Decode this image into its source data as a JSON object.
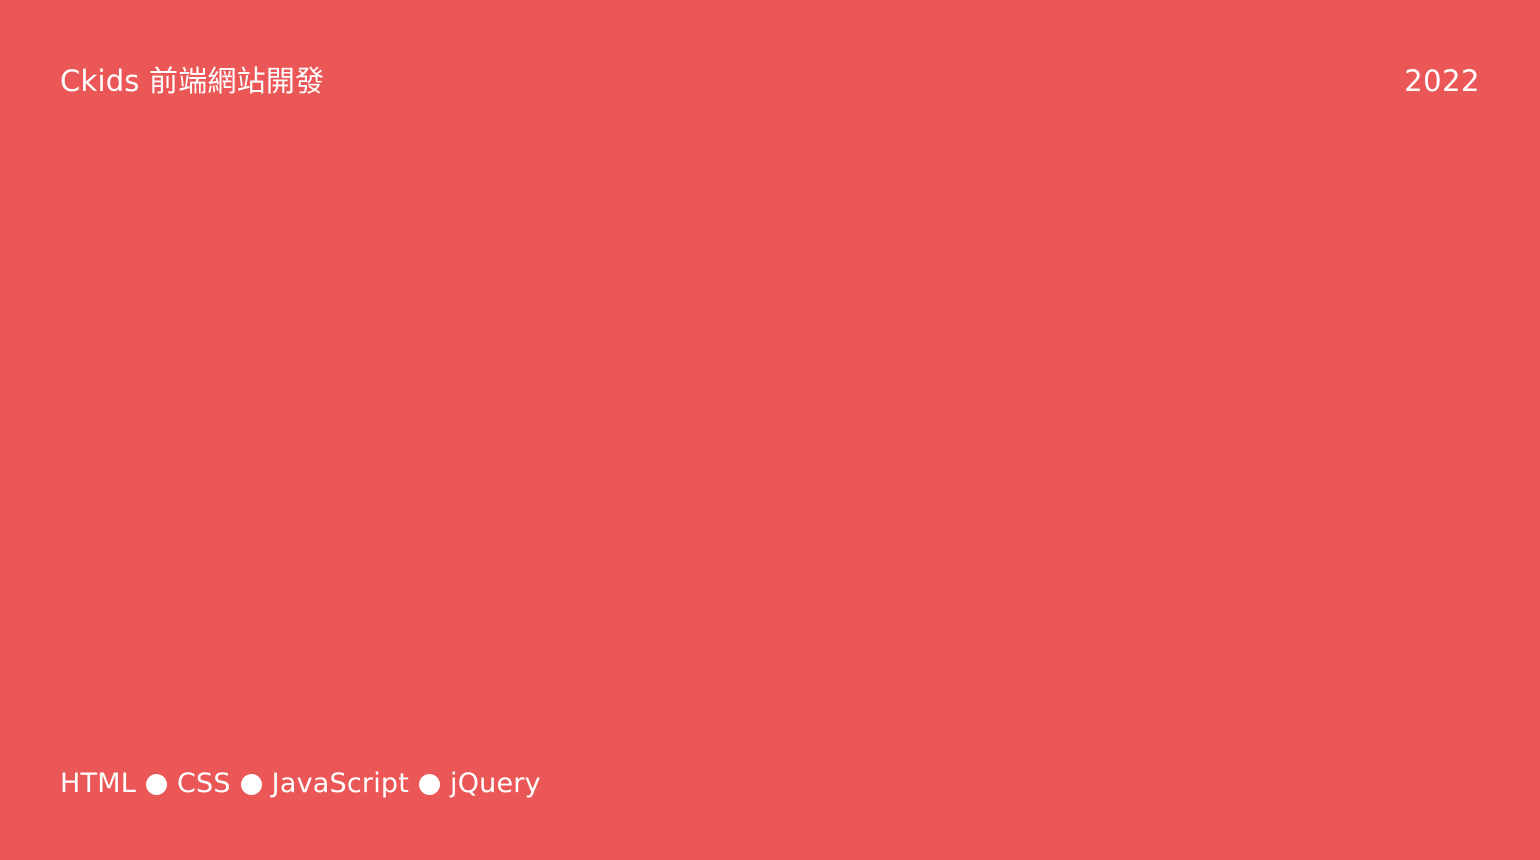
{
  "header": {
    "title": "Ckids 前端網站開發",
    "year": "2022"
  },
  "footer": {
    "tech_stack": [
      "HTML",
      "CSS",
      "JavaScript",
      "jQuery"
    ],
    "separator_icon": "dot-icon"
  },
  "colors": {
    "background": "#EA5756",
    "text": "#ffffff"
  }
}
